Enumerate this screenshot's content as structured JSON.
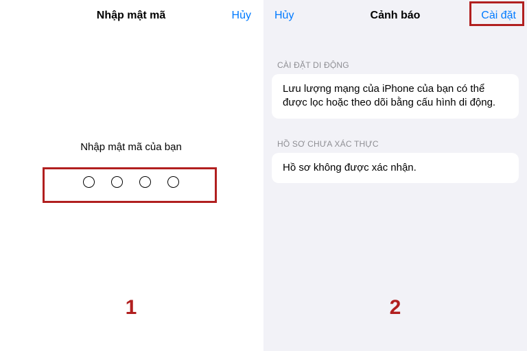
{
  "left": {
    "title": "Nhập mật mã",
    "cancel": "Hủy",
    "prompt": "Nhập mật mã của bạn",
    "step": "1"
  },
  "right": {
    "cancel": "Hủy",
    "title": "Cảnh báo",
    "install": "Cài đặt",
    "section1_header": "CÀI ĐẶT DI ĐỘNG",
    "section1_body": "Lưu lượng mạng của iPhone của bạn có thể được lọc hoặc theo dõi bằng cấu hình di động.",
    "section2_header": "HỒ SƠ CHƯA XÁC THỰC",
    "section2_body": "Hồ sơ không được xác nhận.",
    "step": "2"
  }
}
